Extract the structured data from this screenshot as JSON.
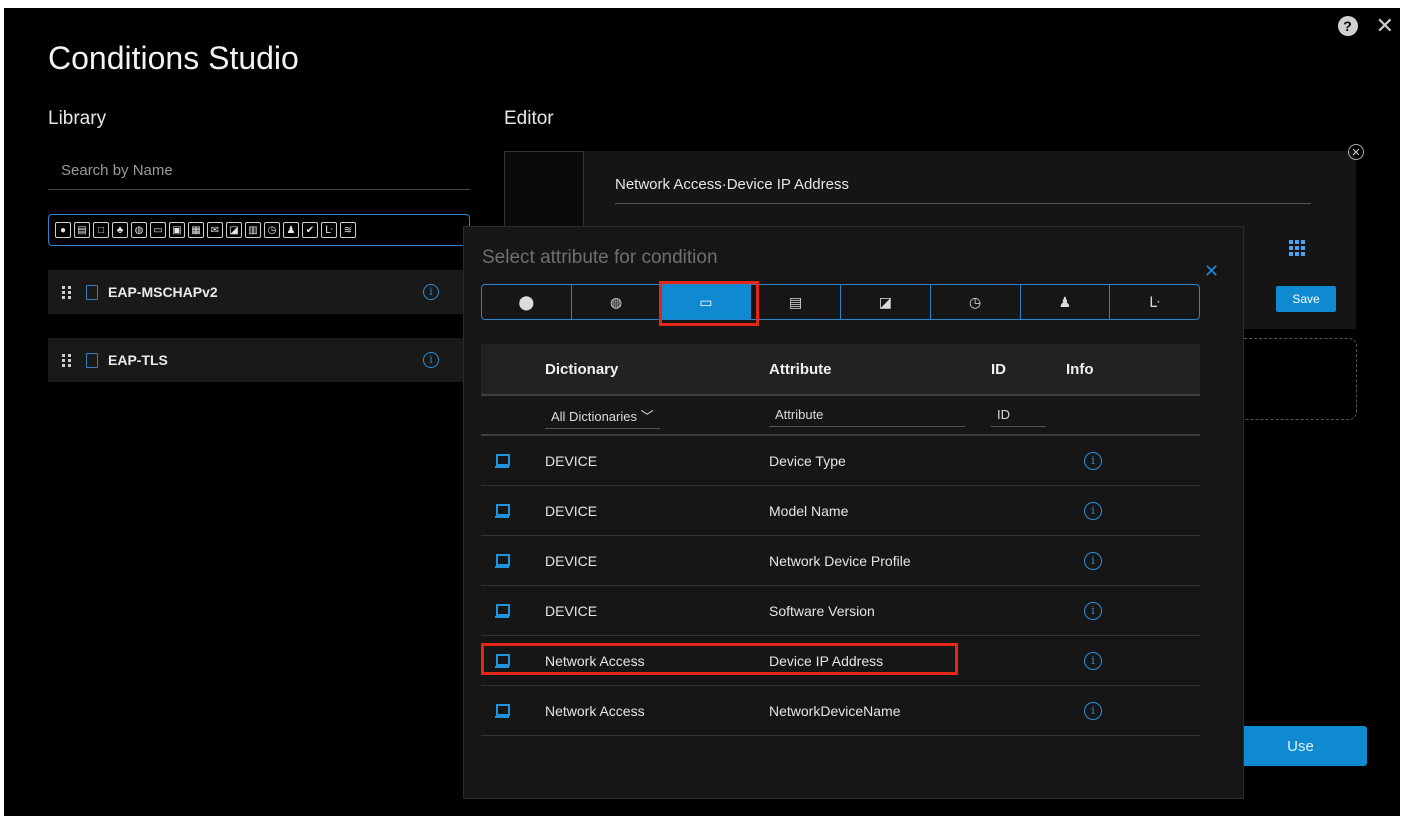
{
  "header": {
    "title": "Conditions Studio",
    "help_icon": "?",
    "close_icon": "✕"
  },
  "library": {
    "label": "Library",
    "search_placeholder": "Search by Name",
    "icon_names": [
      "location-icon",
      "form-icon",
      "square-icon",
      "group-icon",
      "globe-icon",
      "device-icon",
      "monitor-icon",
      "device-alt-icon",
      "mail-icon",
      "phone-icon",
      "building-icon",
      "clock-icon",
      "user-icon",
      "check-icon",
      "tree-icon",
      "wifi-icon"
    ],
    "items": [
      {
        "name": "EAP-MSCHAPv2"
      },
      {
        "name": "EAP-TLS"
      }
    ]
  },
  "editor": {
    "label": "Editor",
    "field_value": "Network Access·Device IP Address",
    "save_label": "Save",
    "use_label": "Use"
  },
  "modal": {
    "title": "Select attribute for condition",
    "tabs": [
      {
        "icon": "location-icon",
        "glyph": "⬤"
      },
      {
        "icon": "globe-icon",
        "glyph": "◍"
      },
      {
        "icon": "device-icon",
        "glyph": "▭",
        "active": true
      },
      {
        "icon": "mail-icon",
        "glyph": "▤"
      },
      {
        "icon": "phone-icon",
        "glyph": "◪"
      },
      {
        "icon": "clock-icon",
        "glyph": "◷"
      },
      {
        "icon": "user-icon",
        "glyph": "♟"
      },
      {
        "icon": "tree-icon",
        "glyph": "ᒷ"
      }
    ],
    "columns": {
      "dictionary": "Dictionary",
      "attribute": "Attribute",
      "id": "ID",
      "info": "Info"
    },
    "filters": {
      "dictionary": "All Dictionaries",
      "attribute": "Attribute",
      "id": "ID"
    },
    "rows": [
      {
        "dictionary": "DEVICE",
        "attribute": "Device Type"
      },
      {
        "dictionary": "DEVICE",
        "attribute": "Model Name"
      },
      {
        "dictionary": "DEVICE",
        "attribute": "Network Device Profile"
      },
      {
        "dictionary": "DEVICE",
        "attribute": "Software Version"
      },
      {
        "dictionary": "Network Access",
        "attribute": "Device IP Address"
      },
      {
        "dictionary": "Network Access",
        "attribute": "NetworkDeviceName"
      }
    ]
  },
  "colors": {
    "accent": "#0f8ad1",
    "highlight": "#e52517",
    "background": "#000000"
  }
}
